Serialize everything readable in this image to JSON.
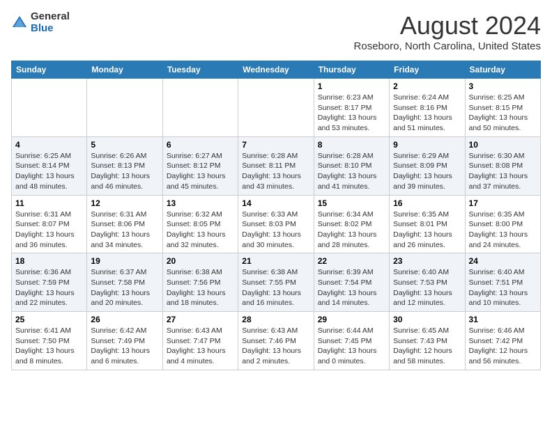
{
  "logo": {
    "general": "General",
    "blue": "Blue"
  },
  "title": "August 2024",
  "location": "Roseboro, North Carolina, United States",
  "days_of_week": [
    "Sunday",
    "Monday",
    "Tuesday",
    "Wednesday",
    "Thursday",
    "Friday",
    "Saturday"
  ],
  "weeks": [
    [
      {
        "day": "",
        "info": ""
      },
      {
        "day": "",
        "info": ""
      },
      {
        "day": "",
        "info": ""
      },
      {
        "day": "",
        "info": ""
      },
      {
        "day": "1",
        "info": "Sunrise: 6:23 AM\nSunset: 8:17 PM\nDaylight: 13 hours\nand 53 minutes."
      },
      {
        "day": "2",
        "info": "Sunrise: 6:24 AM\nSunset: 8:16 PM\nDaylight: 13 hours\nand 51 minutes."
      },
      {
        "day": "3",
        "info": "Sunrise: 6:25 AM\nSunset: 8:15 PM\nDaylight: 13 hours\nand 50 minutes."
      }
    ],
    [
      {
        "day": "4",
        "info": "Sunrise: 6:25 AM\nSunset: 8:14 PM\nDaylight: 13 hours\nand 48 minutes."
      },
      {
        "day": "5",
        "info": "Sunrise: 6:26 AM\nSunset: 8:13 PM\nDaylight: 13 hours\nand 46 minutes."
      },
      {
        "day": "6",
        "info": "Sunrise: 6:27 AM\nSunset: 8:12 PM\nDaylight: 13 hours\nand 45 minutes."
      },
      {
        "day": "7",
        "info": "Sunrise: 6:28 AM\nSunset: 8:11 PM\nDaylight: 13 hours\nand 43 minutes."
      },
      {
        "day": "8",
        "info": "Sunrise: 6:28 AM\nSunset: 8:10 PM\nDaylight: 13 hours\nand 41 minutes."
      },
      {
        "day": "9",
        "info": "Sunrise: 6:29 AM\nSunset: 8:09 PM\nDaylight: 13 hours\nand 39 minutes."
      },
      {
        "day": "10",
        "info": "Sunrise: 6:30 AM\nSunset: 8:08 PM\nDaylight: 13 hours\nand 37 minutes."
      }
    ],
    [
      {
        "day": "11",
        "info": "Sunrise: 6:31 AM\nSunset: 8:07 PM\nDaylight: 13 hours\nand 36 minutes."
      },
      {
        "day": "12",
        "info": "Sunrise: 6:31 AM\nSunset: 8:06 PM\nDaylight: 13 hours\nand 34 minutes."
      },
      {
        "day": "13",
        "info": "Sunrise: 6:32 AM\nSunset: 8:05 PM\nDaylight: 13 hours\nand 32 minutes."
      },
      {
        "day": "14",
        "info": "Sunrise: 6:33 AM\nSunset: 8:03 PM\nDaylight: 13 hours\nand 30 minutes."
      },
      {
        "day": "15",
        "info": "Sunrise: 6:34 AM\nSunset: 8:02 PM\nDaylight: 13 hours\nand 28 minutes."
      },
      {
        "day": "16",
        "info": "Sunrise: 6:35 AM\nSunset: 8:01 PM\nDaylight: 13 hours\nand 26 minutes."
      },
      {
        "day": "17",
        "info": "Sunrise: 6:35 AM\nSunset: 8:00 PM\nDaylight: 13 hours\nand 24 minutes."
      }
    ],
    [
      {
        "day": "18",
        "info": "Sunrise: 6:36 AM\nSunset: 7:59 PM\nDaylight: 13 hours\nand 22 minutes."
      },
      {
        "day": "19",
        "info": "Sunrise: 6:37 AM\nSunset: 7:58 PM\nDaylight: 13 hours\nand 20 minutes."
      },
      {
        "day": "20",
        "info": "Sunrise: 6:38 AM\nSunset: 7:56 PM\nDaylight: 13 hours\nand 18 minutes."
      },
      {
        "day": "21",
        "info": "Sunrise: 6:38 AM\nSunset: 7:55 PM\nDaylight: 13 hours\nand 16 minutes."
      },
      {
        "day": "22",
        "info": "Sunrise: 6:39 AM\nSunset: 7:54 PM\nDaylight: 13 hours\nand 14 minutes."
      },
      {
        "day": "23",
        "info": "Sunrise: 6:40 AM\nSunset: 7:53 PM\nDaylight: 13 hours\nand 12 minutes."
      },
      {
        "day": "24",
        "info": "Sunrise: 6:40 AM\nSunset: 7:51 PM\nDaylight: 13 hours\nand 10 minutes."
      }
    ],
    [
      {
        "day": "25",
        "info": "Sunrise: 6:41 AM\nSunset: 7:50 PM\nDaylight: 13 hours\nand 8 minutes."
      },
      {
        "day": "26",
        "info": "Sunrise: 6:42 AM\nSunset: 7:49 PM\nDaylight: 13 hours\nand 6 minutes."
      },
      {
        "day": "27",
        "info": "Sunrise: 6:43 AM\nSunset: 7:47 PM\nDaylight: 13 hours\nand 4 minutes."
      },
      {
        "day": "28",
        "info": "Sunrise: 6:43 AM\nSunset: 7:46 PM\nDaylight: 13 hours\nand 2 minutes."
      },
      {
        "day": "29",
        "info": "Sunrise: 6:44 AM\nSunset: 7:45 PM\nDaylight: 13 hours\nand 0 minutes."
      },
      {
        "day": "30",
        "info": "Sunrise: 6:45 AM\nSunset: 7:43 PM\nDaylight: 12 hours\nand 58 minutes."
      },
      {
        "day": "31",
        "info": "Sunrise: 6:46 AM\nSunset: 7:42 PM\nDaylight: 12 hours\nand 56 minutes."
      }
    ]
  ]
}
